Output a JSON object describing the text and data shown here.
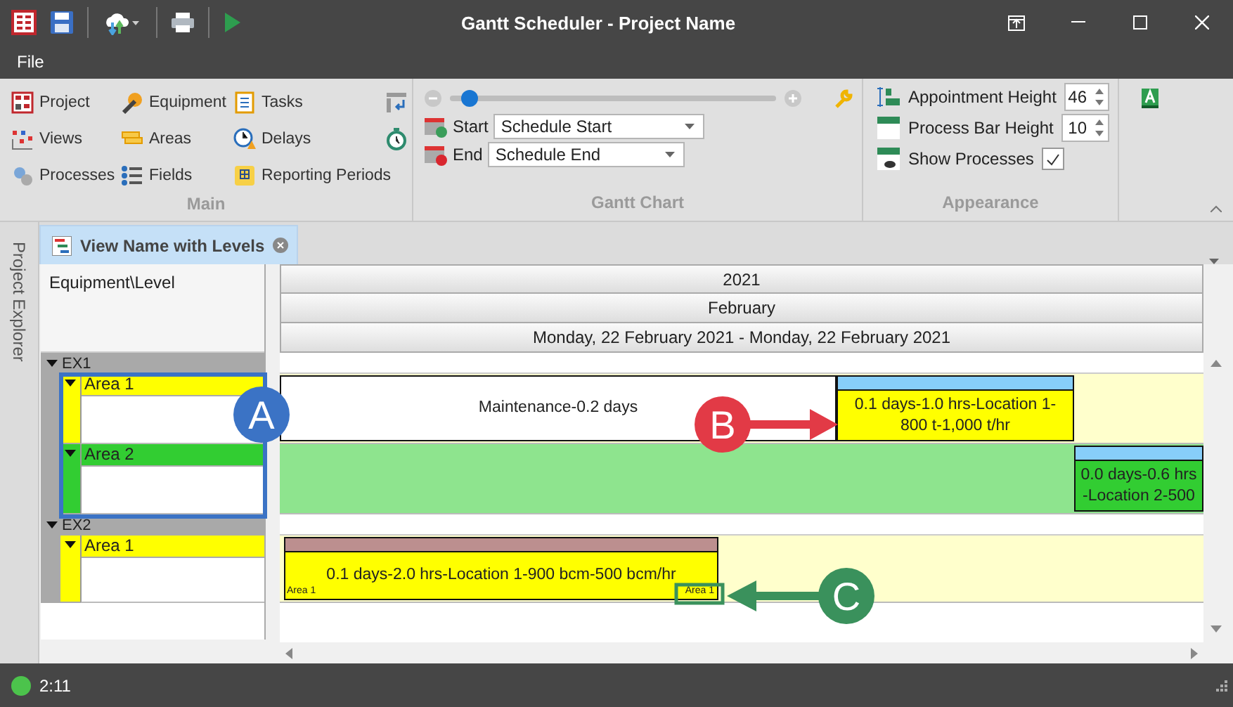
{
  "window": {
    "title": "Gantt Scheduler - Project Name"
  },
  "menu": [
    "File"
  ],
  "ribbon": {
    "main": {
      "title": "Main",
      "items": [
        {
          "label": "Project"
        },
        {
          "label": "Views"
        },
        {
          "label": "Processes"
        },
        {
          "label": "Equipment"
        },
        {
          "label": "Areas"
        },
        {
          "label": "Fields"
        },
        {
          "label": "Tasks"
        },
        {
          "label": "Delays"
        },
        {
          "label": "Reporting Periods"
        }
      ]
    },
    "gantt_chart": {
      "title": "Gantt Chart",
      "zoom": {
        "level": 0.06
      },
      "start": {
        "label": "Start",
        "value": "Schedule Start"
      },
      "end": {
        "label": "End",
        "value": "Schedule End"
      }
    },
    "appearance": {
      "title": "Appearance",
      "spinners": [
        {
          "label": "Appointment Height",
          "value": "46"
        },
        {
          "label": "Process Bar Height",
          "value": "10"
        }
      ],
      "show_processes": {
        "label": "Show Processes",
        "checked": true
      }
    }
  },
  "side_panel": {
    "label": "Project Explorer"
  },
  "tabs": [
    {
      "label": "View Name with Levels",
      "selected": true
    }
  ],
  "grid": {
    "header": "Equipment\\Level",
    "timescale": [
      "2021",
      "February",
      "Monday, 22 February 2021 - Monday, 22 February 2021"
    ],
    "groups": [
      {
        "name": "EX1",
        "expanded": true,
        "children": [
          {
            "name": "Area 1",
            "color": "#ffff00",
            "expanded": true,
            "bars": [
              {
                "kind": "note",
                "text": "Maintenance-0.2 days"
              },
              {
                "kind": "task",
                "text": "0.1 days-1.0 hrs-Location 1-800 t-1,000 t/hr",
                "color": "#87cefa"
              }
            ]
          },
          {
            "name": "Area 2",
            "color": "#32cd32",
            "expanded": true,
            "bars": [
              {
                "kind": "task",
                "text": "0.0 days-0.6 hrs -Location 2-500",
                "color": "#87cefa"
              }
            ]
          }
        ]
      },
      {
        "name": "EX2",
        "expanded": true,
        "children": [
          {
            "name": "Area 1",
            "color": "#ffff00",
            "expanded": true,
            "bars": [
              {
                "kind": "task",
                "text": "0.1 days-2.0 hrs-Location 1-900 bcm-500 bcm/hr",
                "color": "#bc8f8f",
                "tags": [
                  "Area 1",
                  "Area 1"
                ]
              }
            ]
          }
        ]
      }
    ]
  },
  "callouts": [
    {
      "label": "A",
      "color": "#3b73c5"
    },
    {
      "label": "B",
      "color": "#e23a46"
    },
    {
      "label": "C",
      "color": "#3a915c"
    }
  ],
  "status_bar": {
    "text": "2:11"
  }
}
